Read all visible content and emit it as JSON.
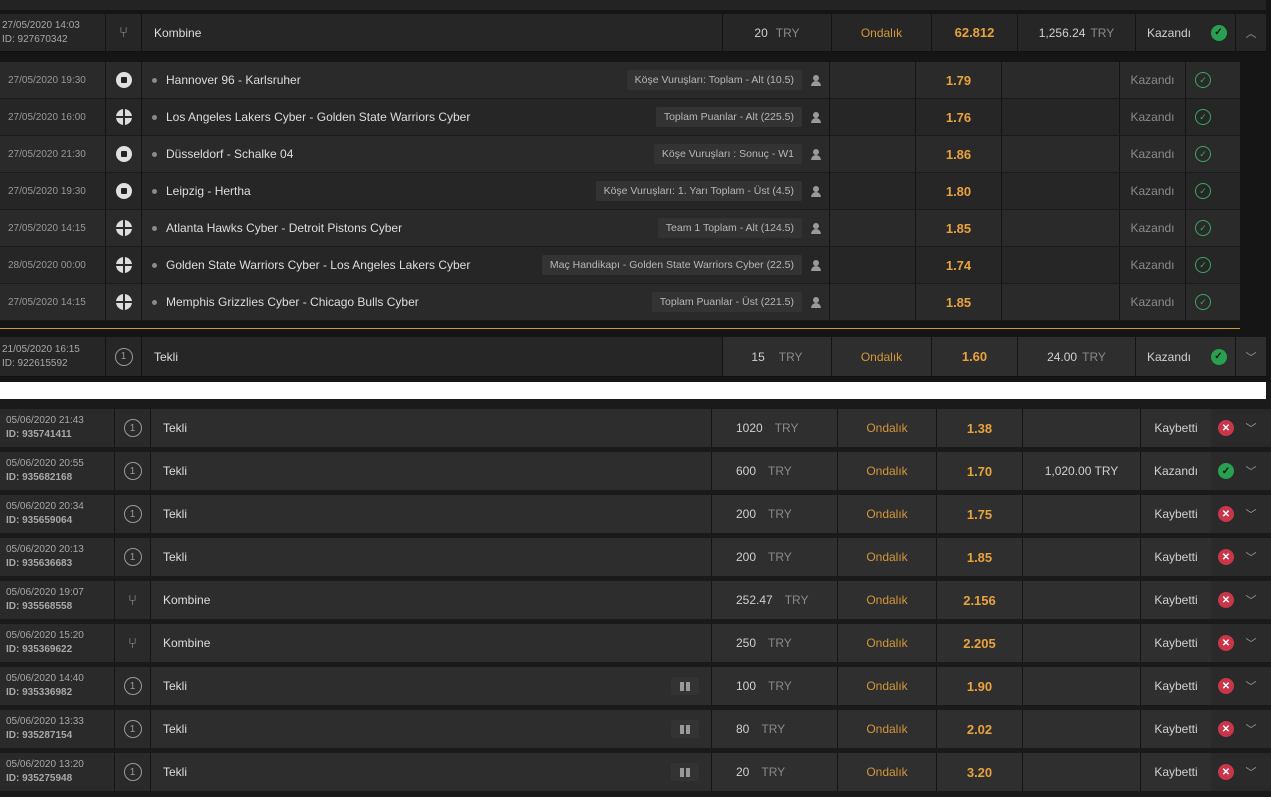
{
  "top_main": {
    "date": "27/05/2020 14:03",
    "id": "ID: 927670342",
    "type": "Kombine",
    "stake": "20",
    "currency": "TRY",
    "odds_format": "Ondalık",
    "odds": "62.812",
    "payout": "1,256.24",
    "payout_currency": "TRY",
    "status": "Kazandı"
  },
  "legs": [
    {
      "date": "27/05/2020 19:30",
      "sport": "football-icon",
      "match": "Hannover 96 - Karlsruher",
      "market": "Köşe Vuruşları: Toplam - Alt (10.5)",
      "odds": "1.79",
      "status": "Kazandı"
    },
    {
      "date": "27/05/2020 16:00",
      "sport": "basketball-icon",
      "match": "Los Angeles Lakers Cyber - Golden State Warriors Cyber",
      "market": "Toplam Puanlar - Alt (225.5)",
      "odds": "1.76",
      "status": "Kazandı"
    },
    {
      "date": "27/05/2020 21:30",
      "sport": "football-icon",
      "match": "Düsseldorf - Schalke 04",
      "market": "Köşe Vuruşları : Sonuç - W1",
      "odds": "1.86",
      "status": "Kazandı"
    },
    {
      "date": "27/05/2020 19:30",
      "sport": "football-icon",
      "match": "Leipzig - Hertha",
      "market": "Köşe Vuruşları: 1. Yarı Toplam - Üst (4.5)",
      "odds": "1.80",
      "status": "Kazandı"
    },
    {
      "date": "27/05/2020 14:15",
      "sport": "basketball-icon",
      "match": "Atlanta Hawks Cyber - Detroit Pistons Cyber",
      "market": "Team 1 Toplam - Alt (124.5)",
      "odds": "1.85",
      "status": "Kazandı"
    },
    {
      "date": "28/05/2020 00:00",
      "sport": "basketball-icon",
      "match": "Golden State Warriors Cyber - Los Angeles Lakers Cyber",
      "market": "Maç Handikapı - Golden State Warriors Cyber (22.5)",
      "odds": "1.74",
      "status": "Kazandı"
    },
    {
      "date": "27/05/2020 14:15",
      "sport": "basketball-icon",
      "match": "Memphis Grizzlies Cyber - Chicago Bulls Cyber",
      "market": "Toplam Puanlar - Üst (221.5)",
      "odds": "1.85",
      "status": "Kazandı"
    }
  ],
  "top_second": {
    "date": "21/05/2020 16:15",
    "id": "ID: 922615592",
    "type": "Tekli",
    "stake": "15",
    "currency": "TRY",
    "odds_format": "Ondalık",
    "odds": "1.60",
    "payout": "24.00",
    "payout_currency": "TRY",
    "status": "Kazandı"
  },
  "bets": [
    {
      "date": "05/06/2020 21:43",
      "id": "ID: 935741411",
      "type": "Tekli",
      "icon": "single-icon",
      "gift": false,
      "stake": "1020",
      "currency": "TRY",
      "odds_format": "Ondalık",
      "odds": "1.38",
      "payout": "",
      "status": "Kaybetti",
      "won": false
    },
    {
      "date": "05/06/2020 20:55",
      "id": "ID: 935682168",
      "type": "Tekli",
      "icon": "single-icon",
      "gift": false,
      "stake": "600",
      "currency": "TRY",
      "odds_format": "Ondalık",
      "odds": "1.70",
      "payout": "1,020.00 TRY",
      "status": "Kazandı",
      "won": true
    },
    {
      "date": "05/06/2020 20:34",
      "id": "ID: 935659064",
      "type": "Tekli",
      "icon": "single-icon",
      "gift": false,
      "stake": "200",
      "currency": "TRY",
      "odds_format": "Ondalık",
      "odds": "1.75",
      "payout": "",
      "status": "Kaybetti",
      "won": false
    },
    {
      "date": "05/06/2020 20:13",
      "id": "ID: 935636683",
      "type": "Tekli",
      "icon": "single-icon",
      "gift": false,
      "stake": "200",
      "currency": "TRY",
      "odds_format": "Ondalık",
      "odds": "1.85",
      "payout": "",
      "status": "Kaybetti",
      "won": false
    },
    {
      "date": "05/06/2020 19:07",
      "id": "ID: 935568558",
      "type": "Kombine",
      "icon": "combo-icon",
      "gift": false,
      "stake": "252.47",
      "currency": "TRY",
      "odds_format": "Ondalık",
      "odds": "2.156",
      "payout": "",
      "status": "Kaybetti",
      "won": false
    },
    {
      "date": "05/06/2020 15:20",
      "id": "ID: 935369622",
      "type": "Kombine",
      "icon": "combo-icon",
      "gift": false,
      "stake": "250",
      "currency": "TRY",
      "odds_format": "Ondalık",
      "odds": "2.205",
      "payout": "",
      "status": "Kaybetti",
      "won": false
    },
    {
      "date": "05/06/2020 14:40",
      "id": "ID: 935336982",
      "type": "Tekli",
      "icon": "single-icon",
      "gift": true,
      "stake": "100",
      "currency": "TRY",
      "odds_format": "Ondalık",
      "odds": "1.90",
      "payout": "",
      "status": "Kaybetti",
      "won": false
    },
    {
      "date": "05/06/2020 13:33",
      "id": "ID: 935287154",
      "type": "Tekli",
      "icon": "single-icon",
      "gift": true,
      "stake": "80",
      "currency": "TRY",
      "odds_format": "Ondalık",
      "odds": "2.02",
      "payout": "",
      "status": "Kaybetti",
      "won": false
    },
    {
      "date": "05/06/2020 13:20",
      "id": "ID: 935275948",
      "type": "Tekli",
      "icon": "single-icon",
      "gift": true,
      "stake": "20",
      "currency": "TRY",
      "odds_format": "Ondalık",
      "odds": "3.20",
      "payout": "",
      "status": "Kaybetti",
      "won": false
    }
  ]
}
